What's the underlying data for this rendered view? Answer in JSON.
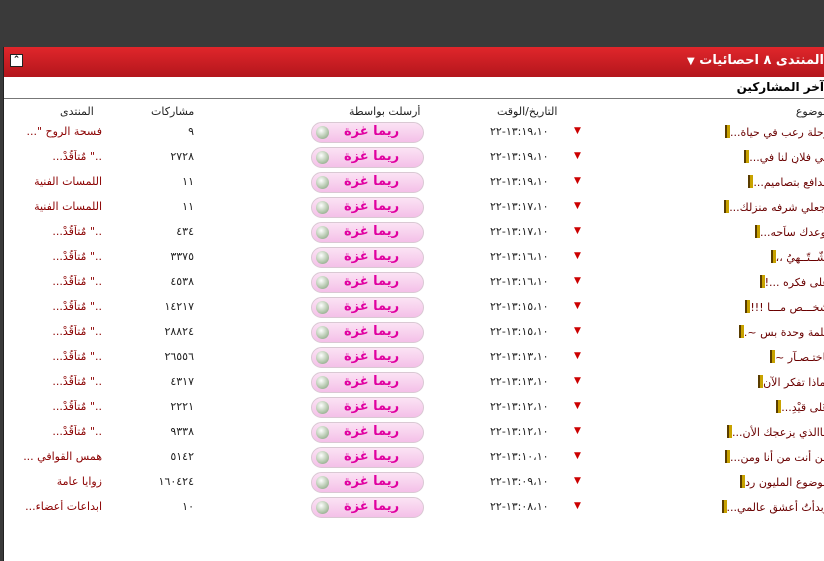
{
  "panel": {
    "title": "المنتدى ٨ احصائيات",
    "collapse_icon": "collapse-arrows-icon",
    "subtitle": "آخر المشاركين",
    "accent": "#d11f25"
  },
  "columns": {
    "topic": "موضوع",
    "datetime": "التاريخ/الوقت",
    "sent_by": "أرسلت بواسطة",
    "posts": "مشاركات",
    "forum": "المنتدى"
  },
  "rows": [
    {
      "topic": "رحلة رعب في حياة...",
      "date": "١٣:١٩،١٠-٢٢",
      "user": "ريما غزة",
      "posts": "٩",
      "forum": "فسحة الروح \"..."
    },
    {
      "topic": "في فلانٍ لنا في...",
      "date": "١٣:١٩،١٠-٢٢",
      "user": "ريما غزة",
      "posts": "٢٧٢٨",
      "forum": "..\" مٌتاَقُدْ..."
    },
    {
      "topic": "مدافع بتصاميم...",
      "date": "١٣:١٩،١٠-٢٢",
      "user": "ريما غزة",
      "posts": "١١",
      "forum": "اللمسات الفنية"
    },
    {
      "topic": "اجعلي شرفه منزلك...",
      "date": "١٣:١٧،١٠-٢٢",
      "user": "ريما غزة",
      "posts": "١١",
      "forum": "اللمسات الفنية"
    },
    {
      "topic": "أوعدك ساَحه...",
      "date": "١٣:١٧،١٠-٢٢",
      "user": "ريما غزة",
      "posts": "٤٣٤",
      "forum": "..\" مٌتاَقُدْ..."
    },
    {
      "topic": "أشّــتّــهِيُ ،،",
      "date": "١٣:١٦،١٠-٢٢",
      "user": "ريما غزة",
      "posts": "٣٣٧٥",
      "forum": "..\" مٌتاَقُدْ..."
    },
    {
      "topic": "على فكره ...!",
      "date": "١٣:١٦،١٠-٢٢",
      "user": "ريما غزة",
      "posts": "٤٥٣٨",
      "forum": "..\" مٌتاَقُدْ..."
    },
    {
      "topic": "شخـــص مـــا !!!",
      "date": "١٣:١٥،١٠-٢٢",
      "user": "ريما غزة",
      "posts": "١٤٢١٧",
      "forum": "..\" مٌتاَقُدْ..."
    },
    {
      "topic": "كلمة وحدة بس ~.",
      "date": "١٣:١٥،١٠-٢٢",
      "user": "ريما غزة",
      "posts": "٢٨٨٢٤",
      "forum": "..\" مٌتاَقُدْ..."
    },
    {
      "topic": "باختـصـآر ~",
      "date": "١٣:١٣،١٠-٢٢",
      "user": "ريما غزة",
      "posts": "٢٦٥٥٦",
      "forum": "..\" مٌتاَقُدْ..."
    },
    {
      "topic": "بماذا تفكر الآن",
      "date": "١٣:١٣،١٠-٢٢",
      "user": "ريما غزة",
      "posts": "٤٣١٧",
      "forum": "..\" مٌتاَقُدْ..."
    },
    {
      "topic": "عٓلى قيْدِ...",
      "date": "١٣:١٢،١٠-٢٢",
      "user": "ريما غزة",
      "posts": "٢٢٢١",
      "forum": "..\" مٌتاَقُدْ..."
    },
    {
      "topic": "ماالذي يزعجك الأن...",
      "date": "١٣:١٢،١٠-٢٢",
      "user": "ريما غزة",
      "posts": "٩٣٣٨",
      "forum": "..\" مٌتاَقُدْ..."
    },
    {
      "topic": "من أنت من أنا ومن...",
      "date": "١٣:١٠،١٠-٢٢",
      "user": "ريما غزة",
      "posts": "٥١٤٢",
      "forum": "همس القوافي ..."
    },
    {
      "topic": "موضوع المليون رد",
      "date": "١٣:٠٩،١٠-٢٢",
      "user": "ريما غزة",
      "posts": "١٦٠٤٢٤",
      "forum": "زوايا عامة"
    },
    {
      "topic": "وبدأتُ أعشق عالمي...",
      "date": "١٣:٠٨،١٠-٢٢",
      "user": "ريما غزة",
      "posts": "١٠",
      "forum": "ابداعات أعضاء..."
    }
  ]
}
